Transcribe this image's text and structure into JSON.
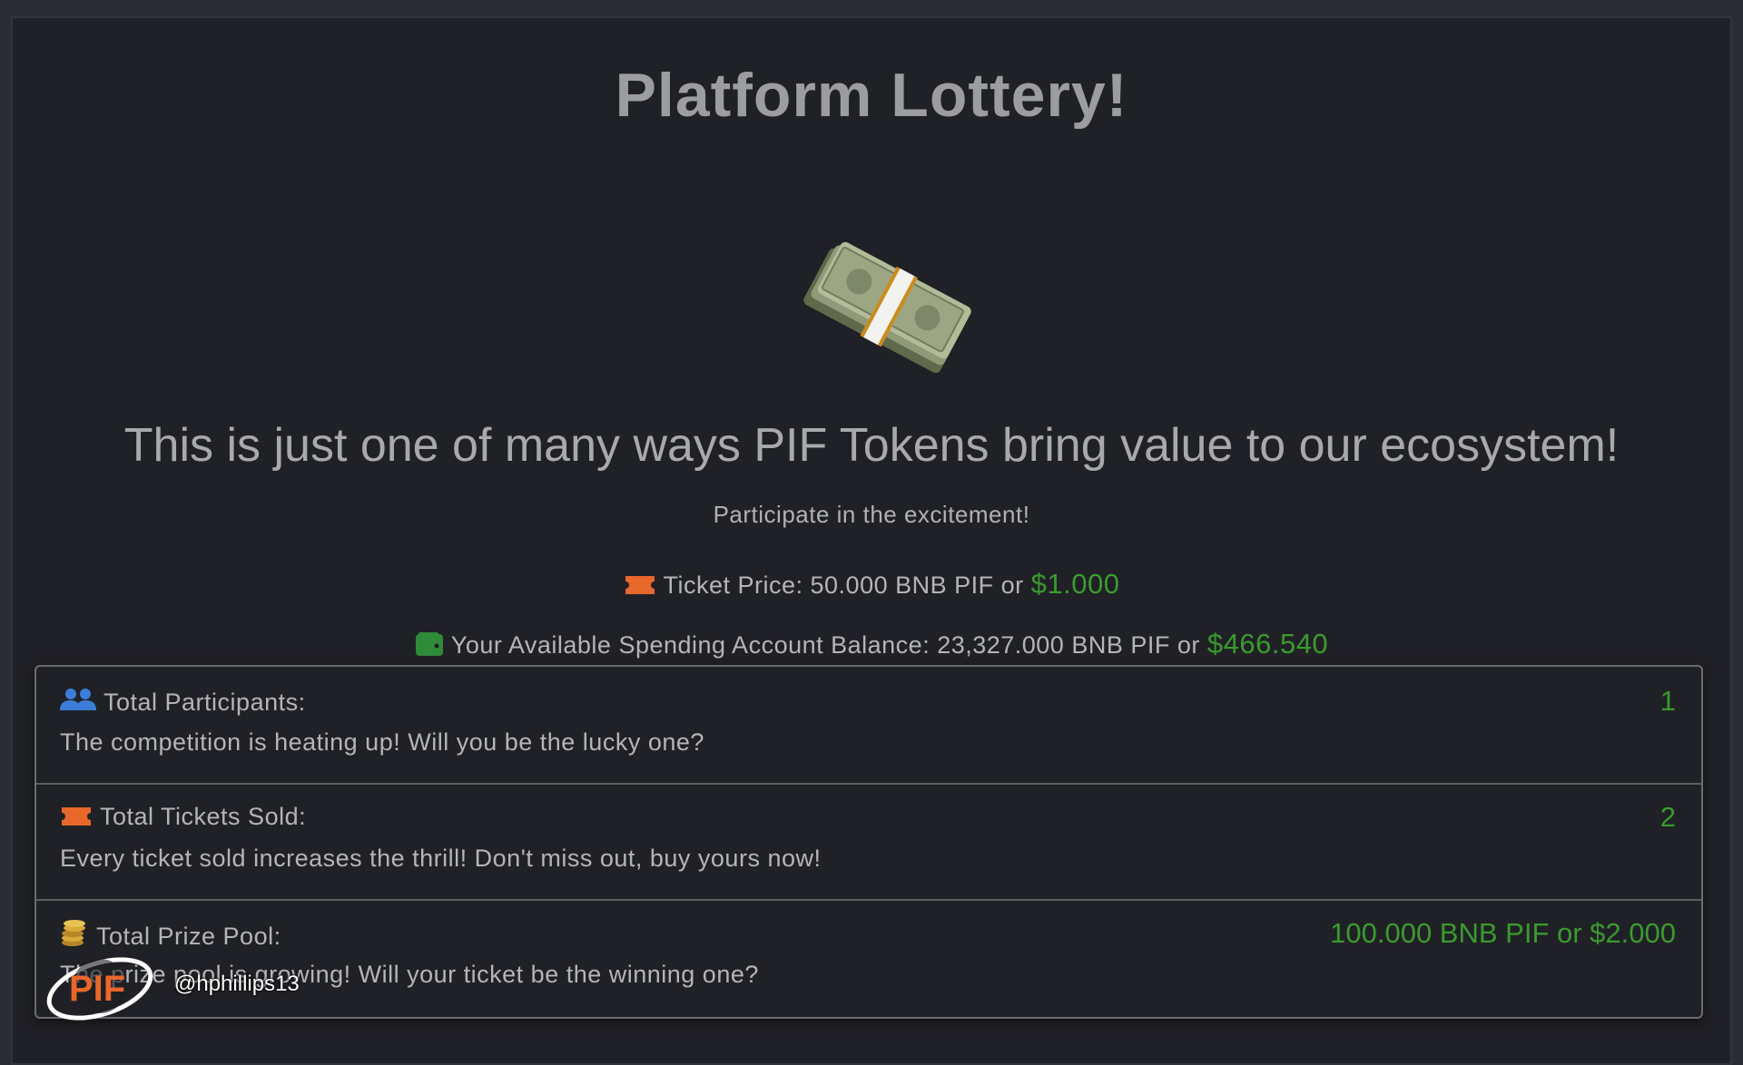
{
  "page": {
    "title": "Platform Lottery!",
    "tagline": "This is just one of many ways PIF Tokens bring value to our ecosystem!",
    "subtitle": "Participate in the excitement!"
  },
  "ticket": {
    "label": "Ticket Price: 50.000 BNB PIF or",
    "usd": "$1.000"
  },
  "balance": {
    "label": "Your Available Spending Account Balance: 23,327.000 BNB PIF or",
    "usd": "$466.540"
  },
  "stats": [
    {
      "icon": "users-icon",
      "label": "Total Participants:",
      "description": "The competition is heating up! Will you be the lucky one?",
      "value": "1"
    },
    {
      "icon": "ticket-icon",
      "label": "Total Tickets Sold:",
      "description": "Every ticket sold increases the thrill! Don't miss out, buy yours now!",
      "value": "2"
    },
    {
      "icon": "coins-icon",
      "label": "Total Prize Pool:",
      "description": "The prize pool is growing! Will your ticket be the winning one?",
      "value": "100.000 BNB PIF or $2.000"
    }
  ],
  "watermark": {
    "logo_text": "PIF",
    "handle": "@hphillips13"
  },
  "colors": {
    "accent_green": "#3a9a2e",
    "ticket_orange": "#e8672a",
    "wallet_green": "#2e8b3a",
    "users_blue": "#3b7dd8",
    "coins_gold": "#d9a93a"
  }
}
